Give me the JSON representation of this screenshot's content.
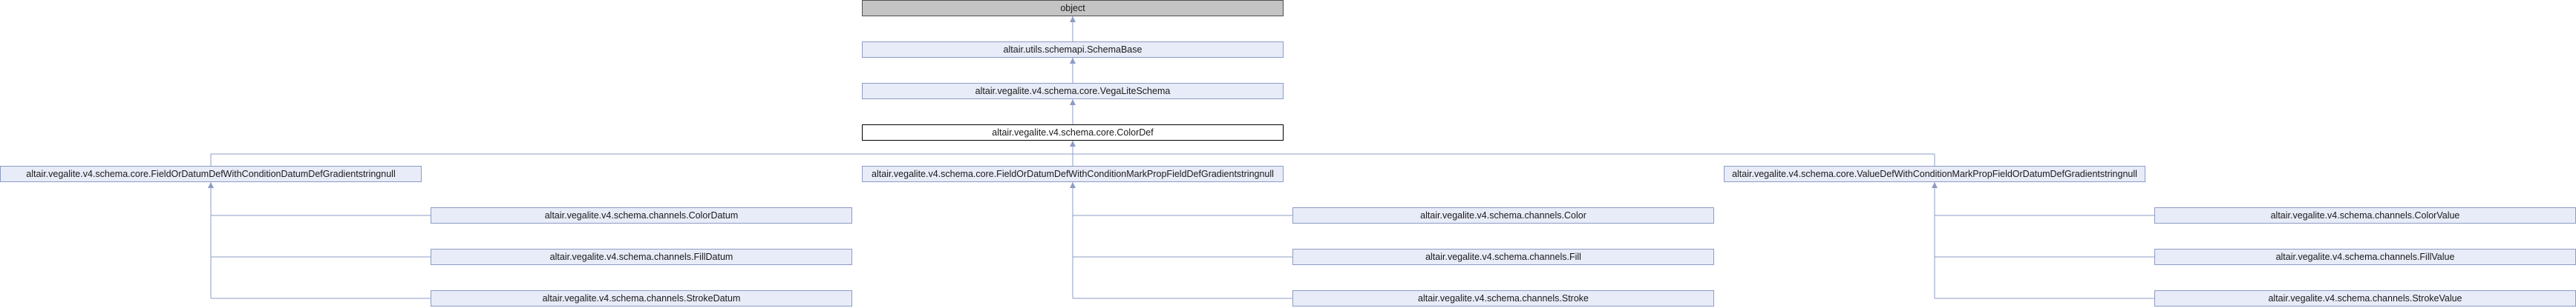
{
  "diagram": {
    "nodes": [
      {
        "id": "object",
        "label": "object",
        "style": "root"
      },
      {
        "id": "schemabase",
        "label": "altair.utils.schemapi.SchemaBase",
        "style": "normal"
      },
      {
        "id": "vegaliteschema",
        "label": "altair.vegalite.v4.schema.core.VegaLiteSchema",
        "style": "normal"
      },
      {
        "id": "colordef",
        "label": "altair.vegalite.v4.schema.core.ColorDef",
        "style": "current"
      },
      {
        "id": "fodcond",
        "label": "altair.vegalite.v4.schema.core.FieldOrDatumDefWithConditionDatumDefGradientstringnull",
        "style": "normal"
      },
      {
        "id": "fodmark",
        "label": "altair.vegalite.v4.schema.core.FieldOrDatumDefWithConditionMarkPropFieldDefGradientstringnull",
        "style": "normal"
      },
      {
        "id": "valuedef",
        "label": "altair.vegalite.v4.schema.core.ValueDefWithConditionMarkPropFieldOrDatumDefGradientstringnull",
        "style": "normal"
      },
      {
        "id": "colordatum",
        "label": "altair.vegalite.v4.schema.channels.ColorDatum",
        "style": "normal"
      },
      {
        "id": "filldatum",
        "label": "altair.vegalite.v4.schema.channels.FillDatum",
        "style": "normal"
      },
      {
        "id": "strokedatum",
        "label": "altair.vegalite.v4.schema.channels.StrokeDatum",
        "style": "normal"
      },
      {
        "id": "color",
        "label": "altair.vegalite.v4.schema.channels.Color",
        "style": "normal"
      },
      {
        "id": "fill",
        "label": "altair.vegalite.v4.schema.channels.Fill",
        "style": "normal"
      },
      {
        "id": "stroke",
        "label": "altair.vegalite.v4.schema.channels.Stroke",
        "style": "normal"
      },
      {
        "id": "colorvalue",
        "label": "altair.vegalite.v4.schema.channels.ColorValue",
        "style": "normal"
      },
      {
        "id": "fillvalue",
        "label": "altair.vegalite.v4.schema.channels.FillValue",
        "style": "normal"
      },
      {
        "id": "strokevalue",
        "label": "altair.vegalite.v4.schema.channels.StrokeValue",
        "style": "normal"
      }
    ],
    "edges": [
      {
        "from": "schemabase",
        "to": "object"
      },
      {
        "from": "vegaliteschema",
        "to": "schemabase"
      },
      {
        "from": "colordef",
        "to": "vegaliteschema"
      },
      {
        "from": "fodcond",
        "to": "colordef"
      },
      {
        "from": "fodmark",
        "to": "colordef"
      },
      {
        "from": "valuedef",
        "to": "colordef"
      },
      {
        "from": "colordatum",
        "to": "fodcond"
      },
      {
        "from": "filldatum",
        "to": "fodcond"
      },
      {
        "from": "strokedatum",
        "to": "fodcond"
      },
      {
        "from": "color",
        "to": "fodmark"
      },
      {
        "from": "fill",
        "to": "fodmark"
      },
      {
        "from": "stroke",
        "to": "fodmark"
      },
      {
        "from": "colorvalue",
        "to": "valuedef"
      },
      {
        "from": "fillvalue",
        "to": "valuedef"
      },
      {
        "from": "strokevalue",
        "to": "valuedef"
      }
    ],
    "colors": {
      "edge": "#8c9cc4",
      "node_fill": "#e8ecf8",
      "root_fill": "#c4c4c4"
    }
  }
}
